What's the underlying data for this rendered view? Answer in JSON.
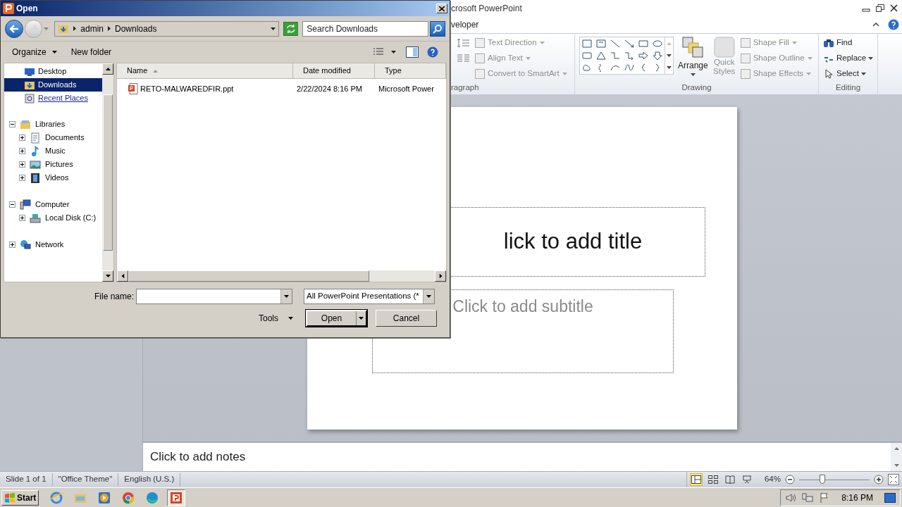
{
  "powerpoint": {
    "title": "crosoft PowerPoint",
    "tab": "veloper",
    "ribbon": {
      "paragraph": {
        "label": "ragraph",
        "commands": [
          {
            "label": "Text Direction",
            "disabled": true
          },
          {
            "label": "Align Text",
            "disabled": true
          },
          {
            "label": "Convert to SmartArt",
            "disabled": true
          }
        ]
      },
      "drawing": {
        "label": "Drawing",
        "arrange": "Arrange",
        "quick_styles": {
          "label": "Quick Styles",
          "disabled": true
        },
        "commands": [
          {
            "label": "Shape Fill",
            "disabled": true
          },
          {
            "label": "Shape Outline",
            "disabled": true
          },
          {
            "label": "Shape Effects",
            "disabled": true
          }
        ]
      },
      "editing": {
        "label": "Editing",
        "commands": [
          {
            "label": "Find",
            "kind": "find",
            "dropdown": false
          },
          {
            "label": "Replace",
            "kind": "replace",
            "dropdown": true
          },
          {
            "label": "Select",
            "kind": "select",
            "dropdown": true
          }
        ]
      }
    },
    "slide": {
      "title_placeholder": "lick to add title",
      "subtitle_placeholder": "Click to add subtitle"
    },
    "notes_placeholder": "Click to add notes",
    "status_bar": {
      "items": [
        "Slide 1 of 1",
        "\"Office Theme\"",
        "English (U.S.)"
      ],
      "views": [
        {
          "kind": "normal",
          "selected": true
        },
        {
          "kind": "sorter",
          "selected": false
        },
        {
          "kind": "reading",
          "selected": false
        },
        {
          "kind": "show",
          "selected": false
        }
      ],
      "zoom": "64%",
      "zoom_slider": {
        "level": 0.33
      }
    }
  },
  "dialog": {
    "title": "Open",
    "forward_disabled": true,
    "breadcrumb": [
      "admin",
      "Downloads"
    ],
    "search": {
      "placeholder": "Search Downloads"
    },
    "toolbar": {
      "organize": "Organize",
      "new_folder": "New folder"
    },
    "favorites": [
      {
        "label": "Desktop",
        "kind": "desktop",
        "selected": false,
        "hovered": false
      },
      {
        "label": "Downloads",
        "kind": "downloads",
        "selected": true,
        "hovered": false
      },
      {
        "label": "Recent Places",
        "kind": "recent",
        "selected": false,
        "hovered": true
      }
    ],
    "tree": [
      {
        "label": "Libraries",
        "kind": "libraries",
        "expanded": true,
        "children": [
          {
            "label": "Documents",
            "kind": "documents",
            "expanded": false
          },
          {
            "label": "Music",
            "kind": "music",
            "expanded": false
          },
          {
            "label": "Pictures",
            "kind": "pictures",
            "expanded": false
          },
          {
            "label": "Videos",
            "kind": "videos",
            "expanded": false
          }
        ]
      },
      {
        "label": "Computer",
        "kind": "computer",
        "expanded": true,
        "children": [
          {
            "label": "Local Disk (C:)",
            "kind": "disk",
            "expanded": false
          }
        ]
      },
      {
        "label": "Network",
        "kind": "network",
        "expanded": false
      }
    ],
    "columns": [
      {
        "label": "Name",
        "sorted": true
      },
      {
        "label": "Date modified",
        "sorted": false
      },
      {
        "label": "Type",
        "sorted": false
      }
    ],
    "files": [
      {
        "name": "RETO-MALWAREDFIR.ppt",
        "date": "2/22/2024 8:16 PM",
        "type": "Microsoft Power",
        "selected": false
      }
    ],
    "file_name_label": "File name:",
    "file_type": "All PowerPoint Presentations (*",
    "tools": "Tools",
    "open": "Open",
    "cancel": "Cancel"
  },
  "taskbar": {
    "start": "Start",
    "apps": [
      {
        "kind": "ie",
        "selected": false
      },
      {
        "kind": "folder",
        "selected": false
      },
      {
        "kind": "media",
        "selected": false
      },
      {
        "kind": "chrome",
        "selected": false
      },
      {
        "kind": "edge",
        "selected": false
      },
      {
        "kind": "powerpoint",
        "selected": true
      }
    ],
    "clock": "8:16 PM"
  }
}
